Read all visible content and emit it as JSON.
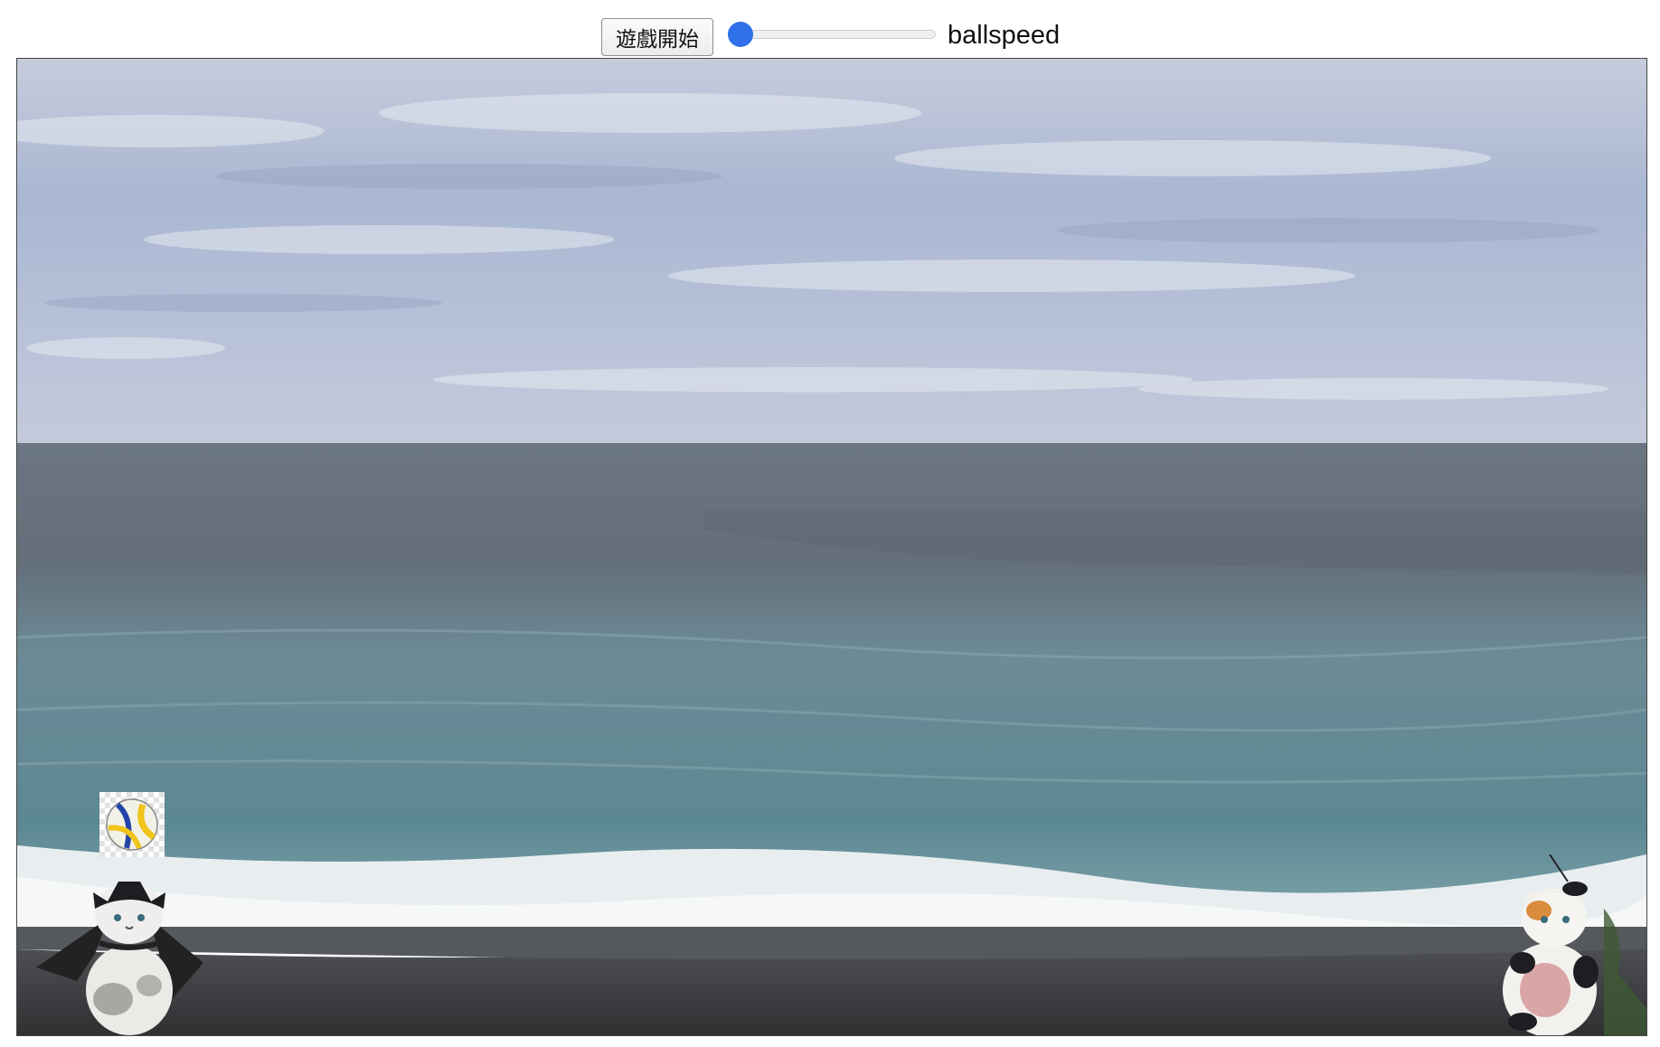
{
  "controls": {
    "start_label": "遊戲開始",
    "slider_label": "ballspeed",
    "ball_speed": 0
  },
  "game": {
    "background": "beach-ocean-scene",
    "left_player": "batman-cat-icon",
    "right_player": "cow-costume-cat-icon",
    "ball": "volleyball-icon"
  },
  "colors": {
    "accent": "#2f6fe8",
    "sky": "#a9b7d4",
    "sea": "#5f8a95",
    "sand": "#3e3e40"
  }
}
